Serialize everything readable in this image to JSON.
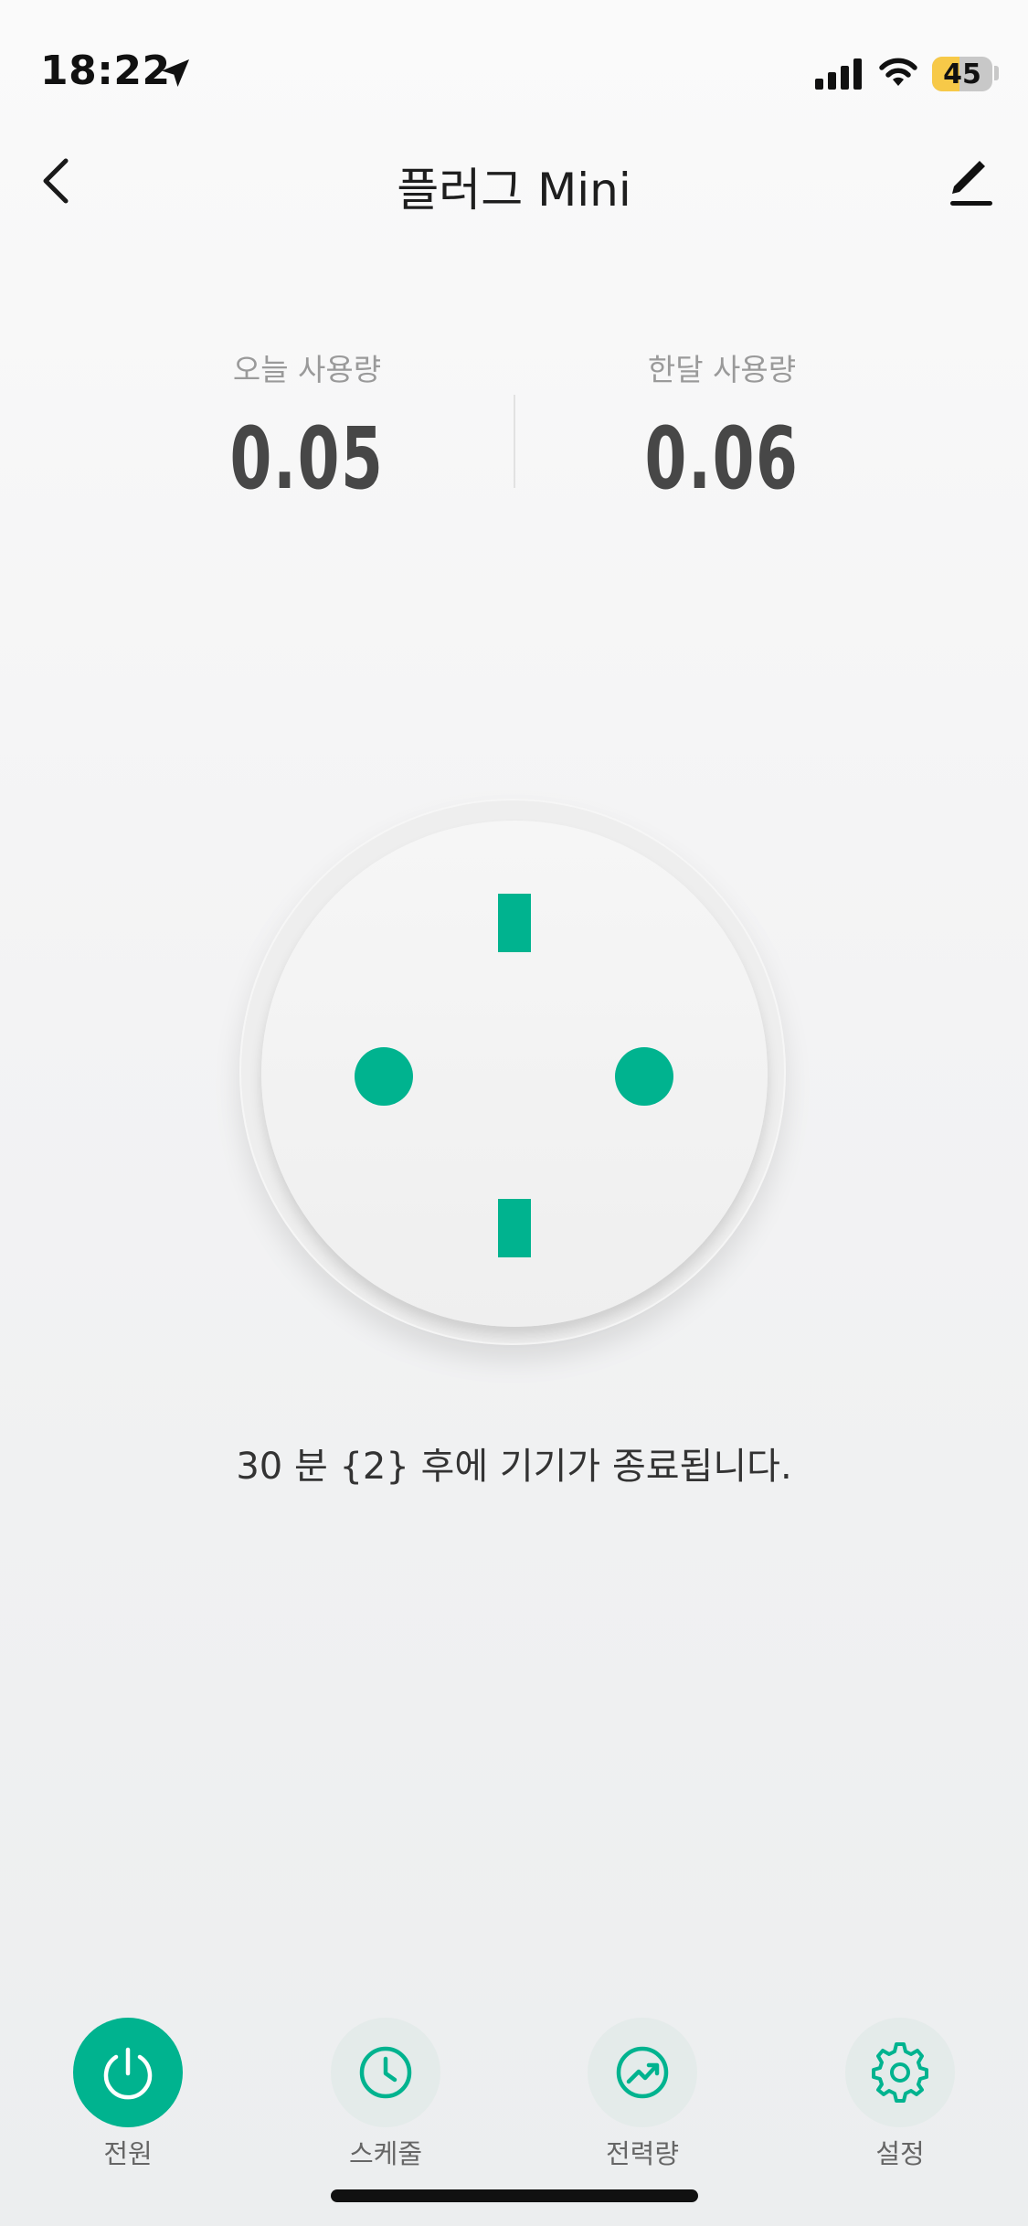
{
  "status_bar": {
    "time": "18:22",
    "battery_level": "45",
    "icons": [
      "location-arrow-icon",
      "cellular-signal-icon",
      "wifi-icon",
      "battery-icon"
    ]
  },
  "header": {
    "title": "플러그 Mini",
    "back_icon": "chevron-left-icon",
    "edit_icon": "pencil-icon"
  },
  "usage": {
    "today_label": "오늘 사용량",
    "today_value": "0.05",
    "month_label": "한달 사용량",
    "month_value": "0.06"
  },
  "socket": {
    "state": "on",
    "accent_color": "#00b38f"
  },
  "timer_message": "30 분 {2} 후에 기기가 종료됩니다.",
  "tabs": [
    {
      "label": "전원",
      "icon": "power-icon",
      "active": true
    },
    {
      "label": "스케줄",
      "icon": "clock-icon",
      "active": false
    },
    {
      "label": "전력량",
      "icon": "trend-chart-icon",
      "active": false
    },
    {
      "label": "설정",
      "icon": "gear-icon",
      "active": false
    }
  ],
  "colors": {
    "accent": "#00b38f",
    "battery": "#f7c948"
  }
}
